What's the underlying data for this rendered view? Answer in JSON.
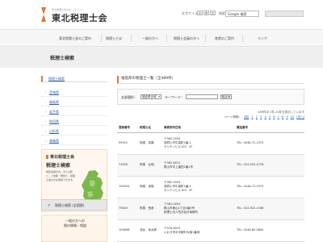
{
  "header": {
    "logo_tagline": "東北税理士会のホームページ",
    "logo_title": "東北税理士会",
    "font_size_label": "文字サイズ",
    "font_sizes": [
      "小",
      "中",
      "大"
    ],
    "search_label": "検索",
    "search_placeholder": "Google 検索",
    "brand_color": "#e8742a"
  },
  "gnav": {
    "items": [
      "東北税理士会のご案内",
      "税理士とは",
      "一般の方へ",
      "税理士会員の方へ",
      "各県のご案内",
      "リンク"
    ]
  },
  "page_title": "税理士検索",
  "sidebar": {
    "section_title": "税理士検索",
    "items": [
      "宮城県",
      "福島県",
      "岩手県",
      "秋田県",
      "山形県",
      "青森県"
    ],
    "banner1": {
      "logo": "東北税理士会",
      "title": "税理士検索",
      "description": "地区会員の方、または別に、ご依頼・問合せ、税理士会の方を検索できます。"
    },
    "banner2_label": "税理士検索 (全国版)",
    "banner3": {
      "line1": "一般の方への",
      "line2": "税の情報・相談"
    }
  },
  "main": {
    "title": "福島県の税理士一覧（全489件）",
    "filter": {
      "area_label": "支部選択：",
      "area_value": "福島県全域",
      "keyword_label": "キーワード：",
      "search_button": "絞込み"
    },
    "result_info": "489件中 1件-20件を表示しています",
    "pager_label": "ページ移動：",
    "pages": [
      "[前]",
      "1",
      "2",
      "3",
      "4",
      "5",
      "6",
      "7",
      "8",
      "9",
      "10",
      "[次へ]"
    ],
    "columns": [
      "登録番号",
      "税理士名",
      "事務所所在地",
      "電話番号"
    ],
    "rows": [
      {
        "no": "95912",
        "name": "阿橋　真喜",
        "addr1": "〒962-0054",
        "addr2": "須賀川市牛袋町1番-1",
        "addr3": "サンテイビル103　2F",
        "tel": "TEL: 0248-72-2370"
      },
      {
        "no": "71830",
        "name": "阿橋　弘明",
        "addr1": "〒963-8031",
        "addr2": "郡山市字上亀田2番1号",
        "addr3": "",
        "tel": "TEL: 024-925-4776"
      },
      {
        "no": "109094",
        "name": "阿橋　良雄",
        "addr1": "〒962-0054",
        "addr2": "須賀川市牛袋町1番-1",
        "addr3": "サンテイビル103　2F",
        "tel": "TEL: 0248-72-2370"
      },
      {
        "no": "70645",
        "name": "阿橋　長彦",
        "addr1": "〒962-0054",
        "addr2": "郡山市東山1丁目5番3号",
        "addr3": "税理士法人荒井会計事務所",
        "tel": "TEL: 024-922-1166"
      },
      {
        "no": "109896",
        "name": "浅谷　幸太郎",
        "addr1": "〒976-8023",
        "addr2": "いわき市平字新町大塩1番地",
        "addr3": "",
        "tel": "TEL: 0246-85-0840"
      }
    ]
  }
}
